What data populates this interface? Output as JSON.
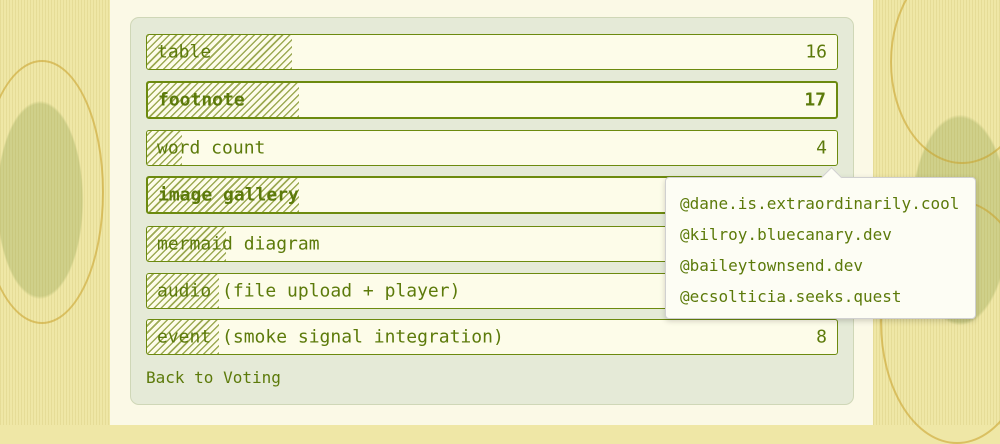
{
  "poll": {
    "options": [
      {
        "name": "table",
        "suffix": "",
        "count": "16",
        "fill": 0.21,
        "bold": false
      },
      {
        "name": "footnote",
        "suffix": "",
        "count": "17",
        "fill": 0.22,
        "bold": true
      },
      {
        "name": "word count",
        "suffix": "",
        "count": "4",
        "fill": 0.05,
        "bold": false
      },
      {
        "name": "image gallery",
        "suffix": "",
        "count": "",
        "fill": 0.22,
        "bold": true
      },
      {
        "name": "mermaid diagram",
        "suffix": "",
        "count": "",
        "fill": 0.115,
        "bold": false
      },
      {
        "name": "audio",
        "suffix": " (file upload + player)",
        "count": "",
        "fill": 0.105,
        "bold": false
      },
      {
        "name": "event",
        "suffix": " (smoke signal integration)",
        "count": "8",
        "fill": 0.105,
        "bold": false
      }
    ]
  },
  "back_link": "Back to Voting",
  "voters_tooltip": {
    "users": [
      "@dane.is.extraordinarily.cool",
      "@kilroy.bluecanary.dev",
      "@baileytownsend.dev",
      "@ecsolticia.seeks.quest"
    ]
  },
  "colors": {
    "accent": "#5c7a0a",
    "panel": "#e5ead7",
    "border": "#6c8a0f"
  }
}
